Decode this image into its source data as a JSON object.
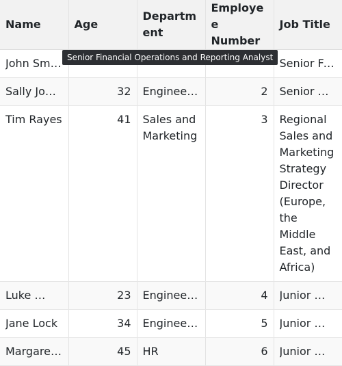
{
  "columns": [
    {
      "label": "Name"
    },
    {
      "label": "Age"
    },
    {
      "label": "Department"
    },
    {
      "label": "Employee Number"
    },
    {
      "label": "Job Title"
    }
  ],
  "rows": [
    {
      "name": "John Smith",
      "age": "",
      "department": "",
      "employee_number": "",
      "job_title": "Senior Financial Operations and Reporting Analyst"
    },
    {
      "name": "Sally Jones",
      "age": "32",
      "department": "Engineering",
      "employee_number": "2",
      "job_title": "Senior …"
    },
    {
      "name": "Tim Rayes",
      "age": "41",
      "department": "Sales and Marketing",
      "employee_number": "3",
      "job_title": "Regional Sales and Marketing Strategy Director (Europe, the Middle East, and Africa)"
    },
    {
      "name": "Luke …",
      "age": "23",
      "department": "Engineering",
      "employee_number": "4",
      "job_title": "Junior …"
    },
    {
      "name": "Jane Lock",
      "age": "34",
      "department": "Engineering",
      "employee_number": "5",
      "job_title": "Junior …"
    },
    {
      "name": "Margaret…",
      "age": "45",
      "department": "HR",
      "employee_number": "6",
      "job_title": "Junior …"
    }
  ],
  "tooltip": {
    "text": "Senior Financial Operations and Reporting Analyst"
  }
}
